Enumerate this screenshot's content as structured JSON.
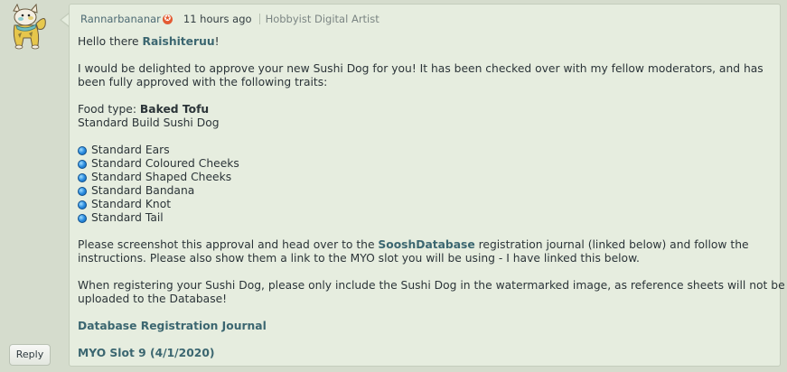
{
  "reply_button": {
    "label": "Reply"
  },
  "avatar": {
    "icon": "creature-avatar-icon"
  },
  "comment": {
    "author": "Rannarbananar",
    "author_badge": "✪",
    "time": "11 hours ago",
    "role": "Hobbyist Digital Artist",
    "greeting_prefix": "Hello there ",
    "greeting_name": "Raishiteruu",
    "greeting_suffix": "!",
    "para1_line1": "I would be delighted to approve your new Sushi Dog for you! It has been checked over with my fellow moderators, and has",
    "para1_line2": "been fully approved with the following traits:",
    "food_type_label": "Food type: ",
    "food_type_value": "Baked Tofu",
    "build": "Standard Build Sushi Dog",
    "traits": [
      "Standard Ears",
      "Standard Coloured Cheeks",
      "Standard Shaped Cheeks",
      "Standard Bandana",
      "Standard Knot",
      "Standard Tail"
    ],
    "para2_line1_prefix": "Please screenshot this approval and head over to the ",
    "para2_link": "SooshDatabase",
    "para2_line1_suffix": " registration journal (linked below) and follow the",
    "para2_line2": "instructions. Please also show them a link to the MYO slot you will be using - I have linked this below.",
    "para3_line1": "When registering your Sushi Dog, please only include the Sushi Dog in the watermarked image, as reference sheets will not be",
    "para3_line2": "uploaded to the Database!",
    "link_registration": "Database Registration Journal",
    "link_myo": "MYO Slot 9 (4/1/2020)"
  },
  "colors": {
    "page_bg": "#d5dccd",
    "card_bg": "#e6eddf",
    "link": "#3b6670",
    "badge": "#e35b33",
    "bullet": "#2c8de0"
  }
}
